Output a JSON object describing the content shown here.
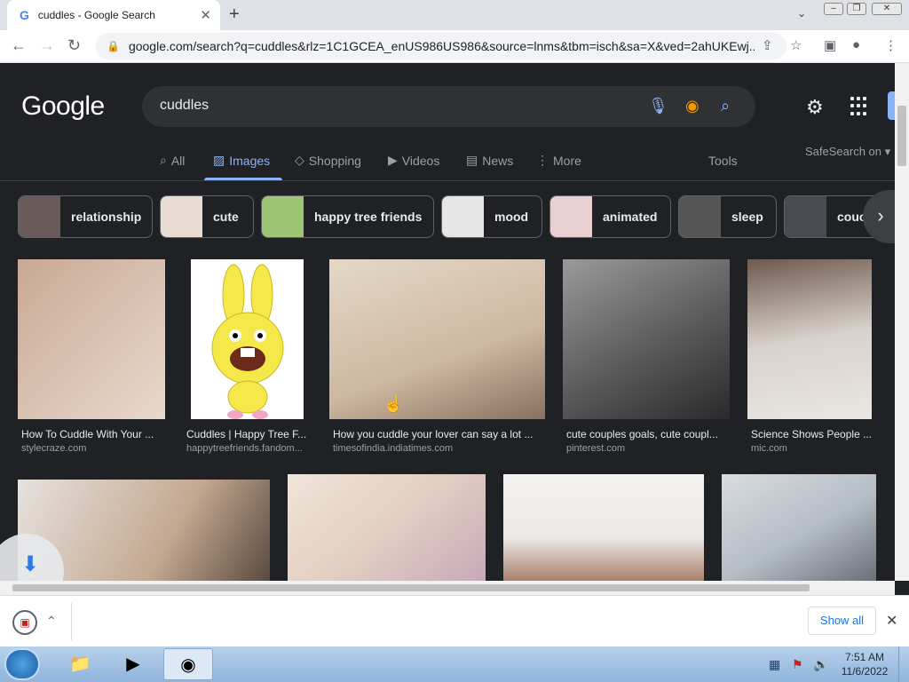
{
  "browser": {
    "tab_title": "cuddles - Google Search",
    "tab_icon": "G",
    "url": "google.com/search?q=cuddles&rlz=1C1GCEA_enUS986US986&source=lnms&tbm=isch&sa=X&ved=2ahUKEwj..."
  },
  "google": {
    "logo": "Google",
    "query": "cuddles",
    "tabs": [
      {
        "label": "All",
        "icon": "search-icon"
      },
      {
        "label": "Images",
        "icon": "image-icon"
      },
      {
        "label": "Shopping",
        "icon": "tag-icon"
      },
      {
        "label": "Videos",
        "icon": "play-icon"
      },
      {
        "label": "News",
        "icon": "newspaper-icon"
      },
      {
        "label": "More",
        "icon": "kebab-icon"
      }
    ],
    "tools": "Tools",
    "safesearch": "SafeSearch on"
  },
  "chips": [
    {
      "label": "relationship",
      "thumb": "#6b5a5a"
    },
    {
      "label": "cute",
      "thumb": "#e8dcd2"
    },
    {
      "label": "happy tree friends",
      "thumb": "#9cc472"
    },
    {
      "label": "mood",
      "thumb": "#e6e6e6"
    },
    {
      "label": "animated",
      "thumb": "#e8cfd0"
    },
    {
      "label": "sleep",
      "thumb": "#555555"
    },
    {
      "label": "couc",
      "thumb": "#4a4a52"
    }
  ],
  "results": [
    {
      "title": "How To Cuddle With Your ...",
      "source": "stylecraze.com",
      "color": "#c9a894"
    },
    {
      "title": "Cuddles | Happy Tree F...",
      "source": "happytreefriends.fandom...",
      "color": "#f4e84a"
    },
    {
      "title": "How you cuddle your lover can say a lot ...",
      "source": "timesofindia.indiatimes.com",
      "color": "#cdb8a0"
    },
    {
      "title": "cute couples goals, cute coupl...",
      "source": "pinterest.com",
      "color": "#6e6e6e"
    },
    {
      "title": "Science Shows People ...",
      "source": "mic.com",
      "color": "#a89b90"
    },
    {
      "title": "",
      "source": "",
      "color": "#d8d2cc"
    },
    {
      "title": "",
      "source": "",
      "color": "#e2cfc2"
    },
    {
      "title": "",
      "source": "",
      "color": "#ece8e6"
    },
    {
      "title": "",
      "source": "",
      "color": "#b4bcc4"
    }
  ],
  "download_bar": {
    "show_all": "Show all"
  },
  "taskbar": {
    "time": "7:51 AM",
    "date": "11/6/2022"
  }
}
